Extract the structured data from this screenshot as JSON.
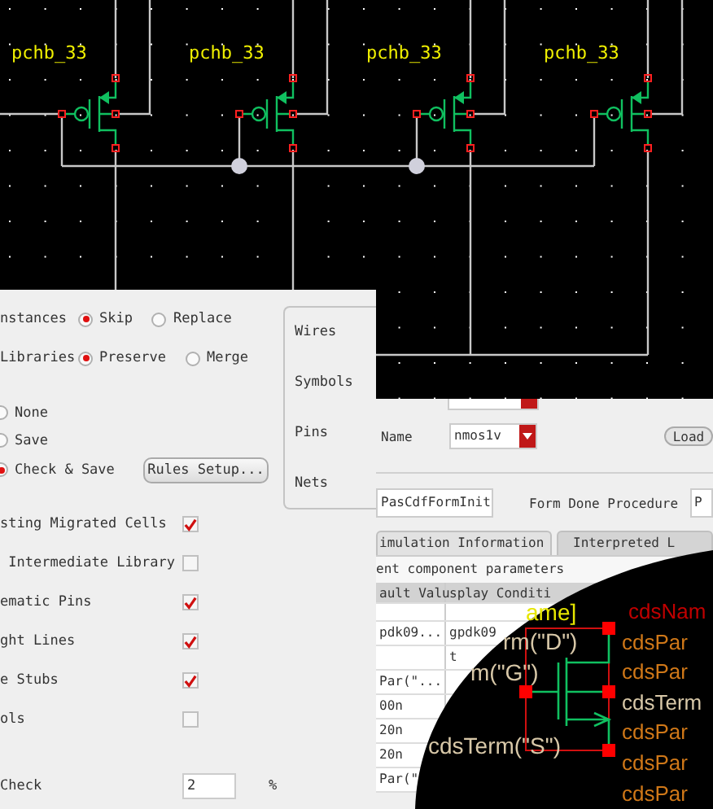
{
  "schematic": {
    "instances": [
      {
        "label": "pchb_33"
      },
      {
        "label": "pchb_33"
      },
      {
        "label": "pchb_33"
      },
      {
        "label": "pchb_33"
      }
    ]
  },
  "migration_dialog": {
    "radio_groups": [
      {
        "label": "nstances",
        "options": [
          {
            "label": "Skip",
            "selected": true
          },
          {
            "label": "Replace",
            "selected": false
          }
        ]
      },
      {
        "label": "Libraries",
        "options": [
          {
            "label": "Preserve",
            "selected": true
          },
          {
            "label": "Merge",
            "selected": false
          }
        ]
      }
    ],
    "save_options": [
      {
        "label": "None",
        "selected": false
      },
      {
        "label": "Save",
        "selected": false
      },
      {
        "label": "Check & Save",
        "selected": true
      }
    ],
    "rules_button": "Rules Setup...",
    "side_panel": [
      "Wires",
      "Symbols",
      "Pins",
      "Nets"
    ],
    "checkboxes": [
      {
        "label": "sting Migrated Cells",
        "checked": true
      },
      {
        "label": " Intermediate Library",
        "checked": false
      },
      {
        "label": "ematic Pins",
        "checked": true
      },
      {
        "label": "ght Lines",
        "checked": true
      },
      {
        "label": "e Stubs",
        "checked": true
      },
      {
        "label": "ols",
        "checked": false
      }
    ],
    "check_field": {
      "label": "Check",
      "value": "2",
      "unit": "%"
    }
  },
  "cdf_editor": {
    "name_label": "Name",
    "cell_name": "nmos1v",
    "load_button": "Load",
    "init_procedure": "PasCdfFormInit",
    "done_label": "Form Done Procedure",
    "done_procedure": "P",
    "tabs": [
      {
        "label": "imulation Information",
        "selected": true
      },
      {
        "label": "Interpreted L",
        "selected": false
      }
    ],
    "section_label": "ent component parameters",
    "table": {
      "columns": [
        "ault Valu",
        "splay Conditi"
      ],
      "rows": [
        {
          "column_1": ""
        },
        {
          "column_1": "pdk09...",
          "column_2": "gpdk09"
        },
        {
          "column_1": "",
          "column_2": "t"
        },
        {
          "column_1": "Par(\"..."
        },
        {
          "column_1": "00n"
        },
        {
          "column_1": "20n"
        },
        {
          "column_1": "20n"
        },
        {
          "column_1": "Par(\""
        }
      ]
    }
  },
  "symbol_view": {
    "left_labels": [
      {
        "text": "ame]",
        "color": "#e6e600"
      },
      {
        "text": "rm(\"D\")",
        "color": "#d8c8a8"
      },
      {
        "text": "m(\"G\")",
        "color": "#d8c8a8"
      },
      {
        "text": "cdsTerm(\"S\")",
        "color": "#d8c8a8"
      }
    ],
    "right_labels": [
      {
        "text": "cdsNam",
        "color": "#c00000"
      },
      {
        "text": "cdsPar",
        "color": "#d07818"
      },
      {
        "text": "cdsPar",
        "color": "#d07818"
      },
      {
        "text": "cdsTerm",
        "color": "#d8c8a8"
      },
      {
        "text": "cdsPar",
        "color": "#d07818"
      },
      {
        "text": "cdsPar",
        "color": "#d07818"
      },
      {
        "text": "cdsPar",
        "color": "#d07818"
      }
    ]
  }
}
